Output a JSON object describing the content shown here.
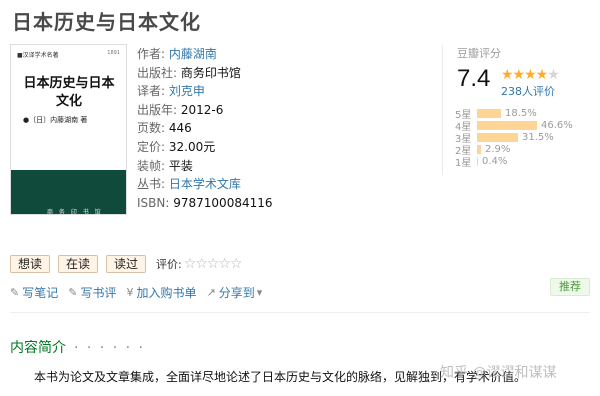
{
  "book": {
    "title": "日本历史与日本文化",
    "cover": {
      "top_label": "■汉译学术名著",
      "top_label2": "1891",
      "title": "日本历史与日本文化",
      "author": "●〔日〕内藤湖南 著",
      "publisher": "商 务 印 书 馆"
    },
    "info": [
      {
        "key": "作者:",
        "value": "内藤湖南",
        "link": true
      },
      {
        "key": "出版社:",
        "value": "商务印书馆",
        "link": false
      },
      {
        "key": "译者:",
        "value": "刘克申",
        "link": true
      },
      {
        "key": "出版年:",
        "value": "2012-6",
        "link": false
      },
      {
        "key": "页数:",
        "value": "446",
        "link": false
      },
      {
        "key": "定价:",
        "value": "32.00元",
        "link": false
      },
      {
        "key": "装帧:",
        "value": "平装",
        "link": false
      },
      {
        "key": "丛书:",
        "value": "日本学术文库",
        "link": true
      },
      {
        "key": "ISBN:",
        "value": "9787100084116",
        "link": false
      }
    ]
  },
  "rating": {
    "label": "豆瓣评分",
    "score": "7.4",
    "stars_on": "★★★★",
    "stars_off": "★",
    "count": "238人评价",
    "distribution": [
      {
        "label": "5星",
        "pct": "18.5%",
        "value": 18.5
      },
      {
        "label": "4星",
        "pct": "46.6%",
        "value": 46.6
      },
      {
        "label": "3星",
        "pct": "31.5%",
        "value": 31.5
      },
      {
        "label": "2星",
        "pct": "2.9%",
        "value": 2.9
      },
      {
        "label": "1星",
        "pct": "0.4%",
        "value": 0.4
      }
    ]
  },
  "actions": {
    "want": "想读",
    "reading": "在读",
    "read": "读过",
    "rate_label": "评价:",
    "rate_stars": "☆☆☆☆☆",
    "write_note": "写笔记",
    "write_review": "写书评",
    "add_cart": "加入购书单",
    "share": "分享到",
    "recommend": "推荐"
  },
  "intro": {
    "heading": "内容简介",
    "dots": "· · · · · ·",
    "text": "本书为论文及文章集成，全面详尽地论述了日本历史与文化的脉络，见解独到，有学术价值。"
  },
  "watermark": "知乎 @谬谬和谋谋",
  "colors": {
    "link": "#3377aa",
    "green": "#007722",
    "star": "#ffac2d",
    "bar": "#ffd596",
    "cover_green": "#0f4a3b"
  }
}
